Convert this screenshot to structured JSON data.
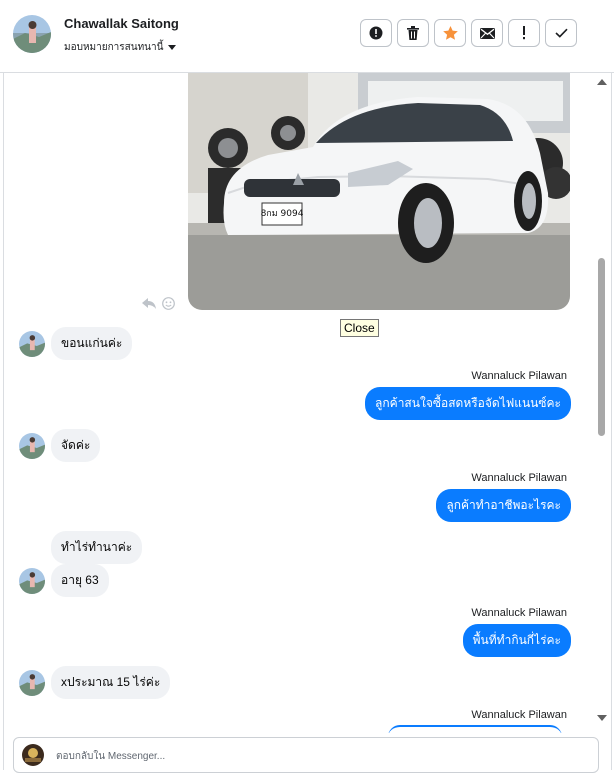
{
  "header": {
    "contact_name": "Chawallak Saitong",
    "assign_label": "มอบหมายการสนทนานี้",
    "toolbar": [
      {
        "name": "spam-button",
        "icon": "alert-circle-icon"
      },
      {
        "name": "delete-button",
        "icon": "trash-icon"
      },
      {
        "name": "star-button",
        "icon": "star-icon"
      },
      {
        "name": "mark-unread-button",
        "icon": "envelope-icon"
      },
      {
        "name": "priority-button",
        "icon": "exclamation-icon"
      },
      {
        "name": "done-button",
        "icon": "check-icon"
      }
    ]
  },
  "thread": {
    "tooltip": "Close",
    "messages": [
      {
        "side": "in",
        "text": "ขอนแก่นค่ะ"
      },
      {
        "side": "out",
        "sender": "Wannaluck Pilawan",
        "text": "ลูกค้าสนใจซื้อสดหรือจัดไฟแนนซ์คะ"
      },
      {
        "side": "in",
        "text": "จัดค่ะ"
      },
      {
        "side": "out",
        "sender": "Wannaluck Pilawan",
        "text": "ลูกค้าทำอาชีพอะไรคะ"
      },
      {
        "side": "in",
        "text": "ทำไร่ทำนาค่ะ"
      },
      {
        "side": "in",
        "text": "อายุ 63"
      },
      {
        "side": "out",
        "sender": "Wannaluck Pilawan",
        "text": "พื้นที่ทำกินกี่ไร่คะ"
      },
      {
        "side": "in",
        "text": "xประมาณ 15 ไร่ค่ะ"
      },
      {
        "side": "out",
        "sender": "Wannaluck Pilawan",
        "text": ""
      }
    ]
  },
  "car_photo": {
    "plate": "8กม 9094"
  },
  "composer": {
    "placeholder": "ตอบกลับใน Messenger..."
  },
  "colors": {
    "outgoing_bubble": "#0a7cff",
    "incoming_bubble": "#f0f2f5",
    "star": "#f7923b"
  }
}
